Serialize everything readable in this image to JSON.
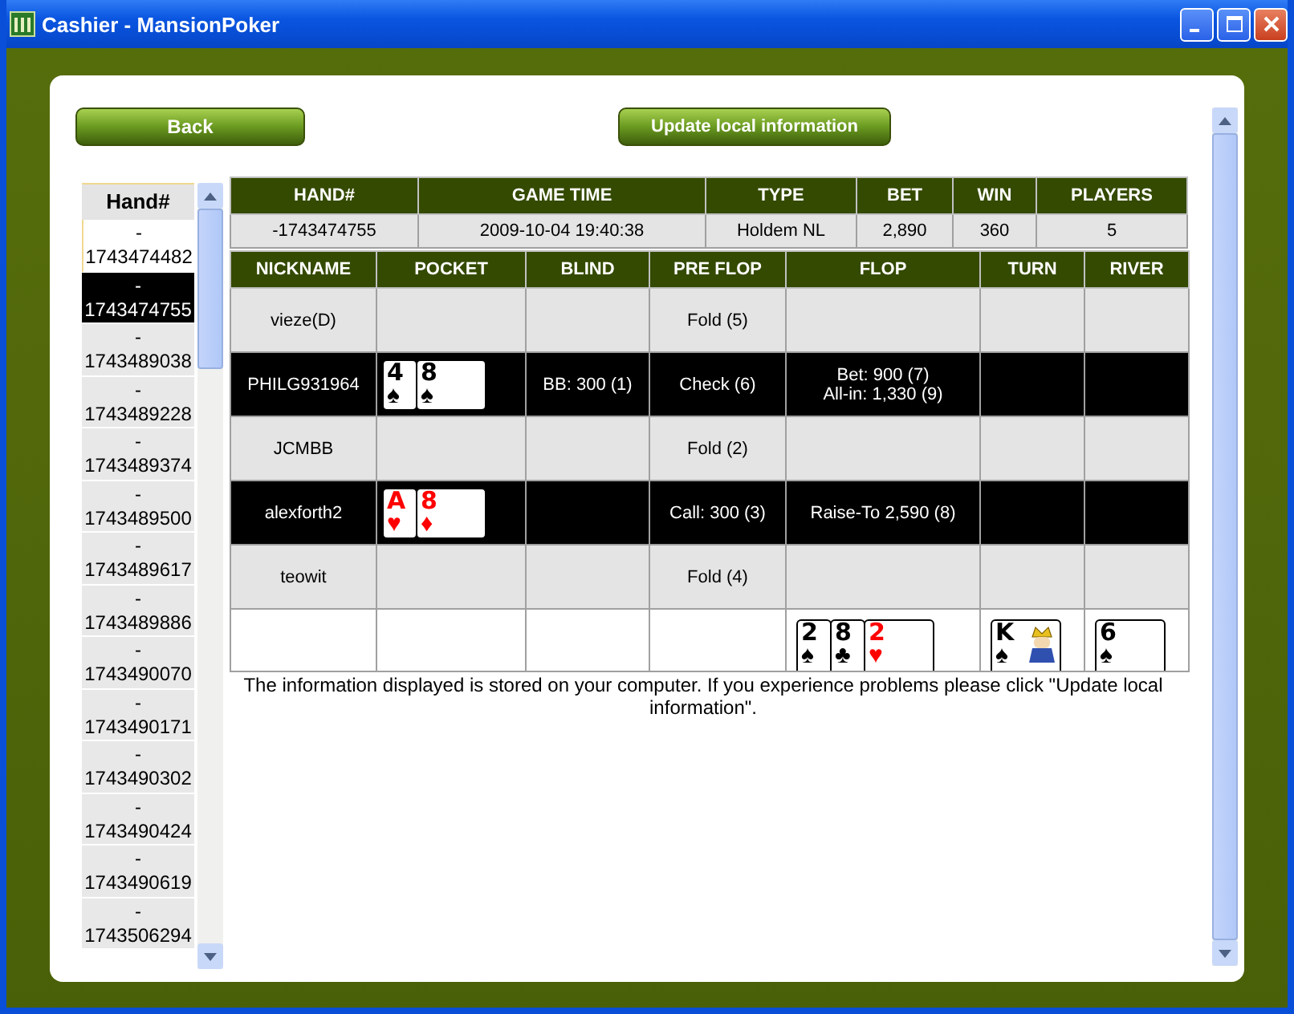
{
  "window": {
    "title": "Cashier - MansionPoker"
  },
  "buttons": {
    "back": "Back",
    "update": "Update local information"
  },
  "hand_list": {
    "header": "Hand#",
    "items": [
      {
        "label": "- 1743474482",
        "selected": false
      },
      {
        "label": "- 1743474755",
        "selected": true
      },
      {
        "label": "- 1743489038",
        "selected": false
      },
      {
        "label": "- 1743489228",
        "selected": false
      },
      {
        "label": "- 1743489374",
        "selected": false
      },
      {
        "label": "- 1743489500",
        "selected": false
      },
      {
        "label": "- 1743489617",
        "selected": false
      },
      {
        "label": "- 1743489886",
        "selected": false
      },
      {
        "label": "- 1743490070",
        "selected": false
      },
      {
        "label": "- 1743490171",
        "selected": false
      },
      {
        "label": "- 1743490302",
        "selected": false
      },
      {
        "label": "- 1743490424",
        "selected": false
      },
      {
        "label": "- 1743490619",
        "selected": false
      },
      {
        "label": "- 1743506294",
        "selected": false
      }
    ]
  },
  "summary": {
    "columns": [
      "HAND#",
      "GAME TIME",
      "TYPE",
      "BET",
      "WIN",
      "PLAYERS"
    ],
    "row": [
      "-1743474755",
      "2009-10-04 19:40:38",
      "Holdem NL",
      "2,890",
      "360",
      "5"
    ]
  },
  "actions": {
    "columns": [
      "NICKNAME",
      "POCKET",
      "BLIND",
      "PRE FLOP",
      "FLOP",
      "TURN",
      "RIVER"
    ],
    "players": [
      {
        "nickname": "vieze(D)",
        "highlighted": false,
        "pre_flop": "Fold (5)"
      },
      {
        "nickname": "PHILG931964",
        "highlighted": true,
        "pocket": [
          {
            "rank": "4",
            "suit": "♠",
            "color": "#000000",
            "kind": "pip"
          },
          {
            "rank": "8",
            "suit": "♠",
            "color": "#000000",
            "kind": "pip"
          }
        ],
        "blind": "BB: 300 (1)",
        "pre_flop": "Check (6)",
        "flop": [
          "Bet: 900 (7)",
          "All-in: 1,330 (9)"
        ]
      },
      {
        "nickname": "JCMBB",
        "highlighted": false,
        "pre_flop": "Fold (2)"
      },
      {
        "nickname": "alexforth2",
        "highlighted": true,
        "pocket": [
          {
            "rank": "A",
            "suit": "♥",
            "color": "#ff0000",
            "kind": "pip"
          },
          {
            "rank": "8",
            "suit": "♦",
            "color": "#ff0000",
            "kind": "pip"
          }
        ],
        "pre_flop": "Call: 300 (3)",
        "flop": [
          "Raise-To 2,590 (8)"
        ]
      },
      {
        "nickname": "teowit",
        "highlighted": false,
        "pre_flop": "Fold (4)"
      }
    ],
    "board": {
      "flop": [
        {
          "rank": "2",
          "suit": "♠",
          "color": "#000000",
          "kind": "pip"
        },
        {
          "rank": "8",
          "suit": "♣",
          "color": "#000000",
          "kind": "pip"
        },
        {
          "rank": "2",
          "suit": "♥",
          "color": "#ff0000",
          "kind": "pip"
        }
      ],
      "turn": [
        {
          "rank": "K",
          "suit": "♠",
          "color": "#000000",
          "kind": "court"
        }
      ],
      "river": [
        {
          "rank": "6",
          "suit": "♠",
          "color": "#000000",
          "kind": "pip"
        }
      ]
    }
  },
  "note": "The information displayed is stored on your computer. If you experience problems please click \"Update local information\"."
}
